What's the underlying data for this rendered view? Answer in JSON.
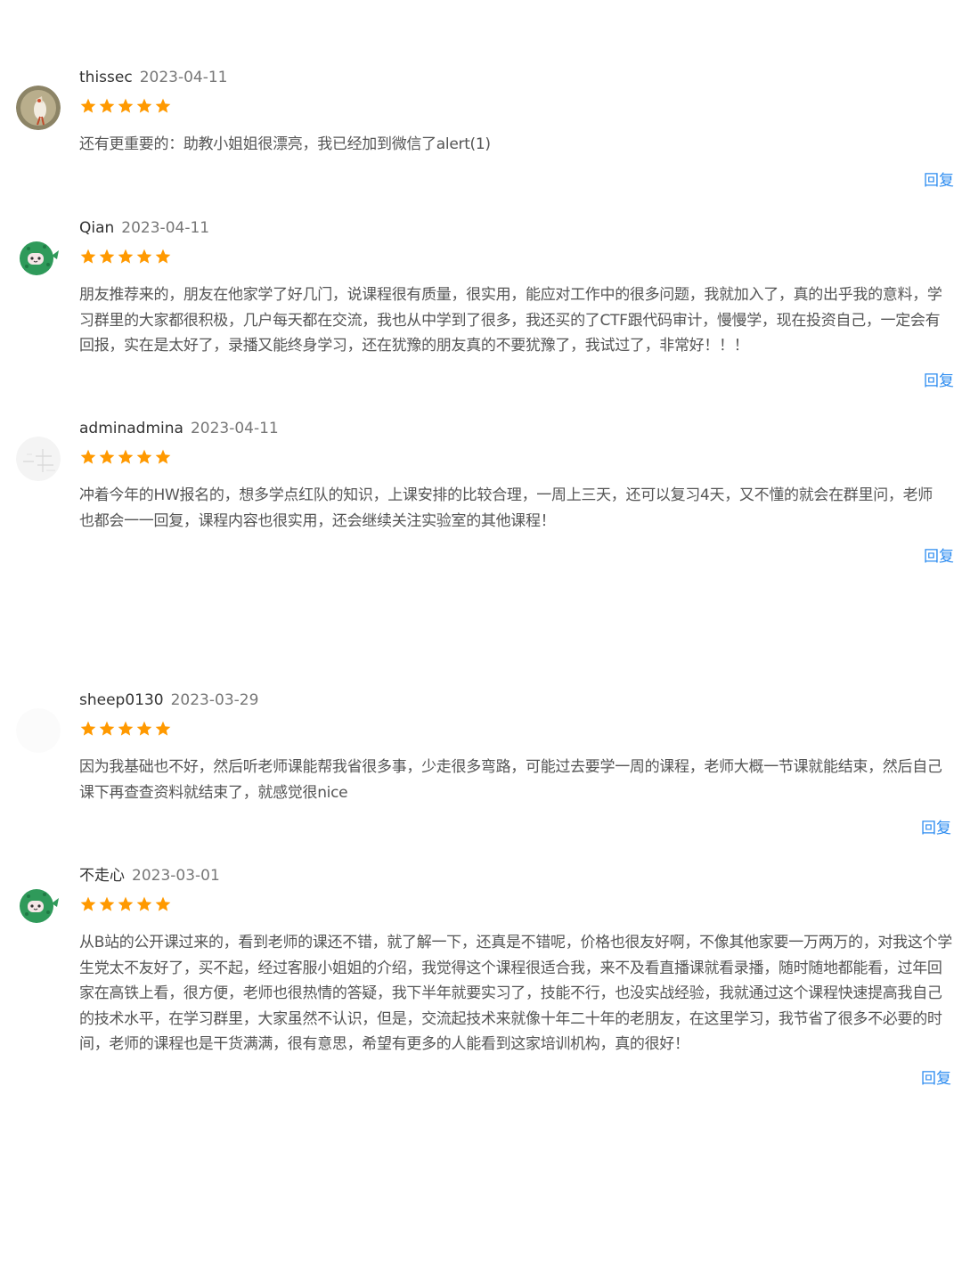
{
  "reviews": [
    {
      "username": "thissec",
      "date": "2023-04-11",
      "rating": 5,
      "avatar_icon": "bird-photo-avatar",
      "content": "还有更重要的：助教小姐姐很漂亮，我已经加到微信了alert(1)",
      "reply_label": "回复"
    },
    {
      "username": "Qian",
      "date": "2023-04-11",
      "rating": 5,
      "avatar_icon": "green-cactus-avatar",
      "content": "朋友推荐来的，朋友在他家学了好几门，说课程很有质量，很实用，能应对工作中的很多问题，我就加入了，真的出乎我的意料，学习群里的大家都很积极，几户每天都在交流，我也从中学到了很多，我还买的了CTF跟代码审计，慢慢学，现在投资自己，一定会有回报，实在是太好了，录播又能终身学习，还在犹豫的朋友真的不要犹豫了，我试过了，非常好！！！",
      "reply_label": "回复"
    },
    {
      "username": "adminadmina",
      "date": "2023-04-11",
      "rating": 5,
      "avatar_icon": "sketch-avatar",
      "content": "冲着今年的HW报名的，想多学点红队的知识，上课安排的比较合理，一周上三天，还可以复习4天，又不懂的就会在群里问，老师也都会一一回复，课程内容也很实用，还会继续关注实验室的其他课程！",
      "reply_label": "回复"
    },
    {
      "username": "sheep0130",
      "date": "2023-03-29",
      "rating": 5,
      "avatar_icon": "blank-avatar",
      "content": "因为我基础也不好，然后听老师课能帮我省很多事，少走很多弯路，可能过去要学一周的课程，老师大概一节课就能结束，然后自己课下再查查资料就结束了，就感觉很nice",
      "reply_label": "回复"
    },
    {
      "username": "不走心",
      "date": "2023-03-01",
      "rating": 5,
      "avatar_icon": "green-cactus-avatar",
      "content": "从B站的公开课过来的，看到老师的课还不错，就了解一下，还真是不错呢，价格也很友好啊，不像其他家要一万两万的，对我这个学生党太不友好了，买不起，经过客服小姐姐的介绍，我觉得这个课程很适合我，来不及看直播课就看录播，随时随地都能看，过年回家在高铁上看，很方便，老师也很热情的答疑，我下半年就要实习了，技能不行，也没实战经验，我就通过这个课程快速提高我自己的技术水平，在学习群里，大家虽然不认识，但是，交流起技术来就像十年二十年的老朋友，在这里学习，我节省了很多不必要的时间，老师的课程也是干货满满，很有意思，希望有更多的人能看到这家培训机构，真的很好！",
      "reply_label": "回复"
    }
  ],
  "colors": {
    "star": "#ff9900",
    "reply_link": "#2d8cf0",
    "username": "#333333",
    "date": "#777777",
    "content": "#555555"
  }
}
